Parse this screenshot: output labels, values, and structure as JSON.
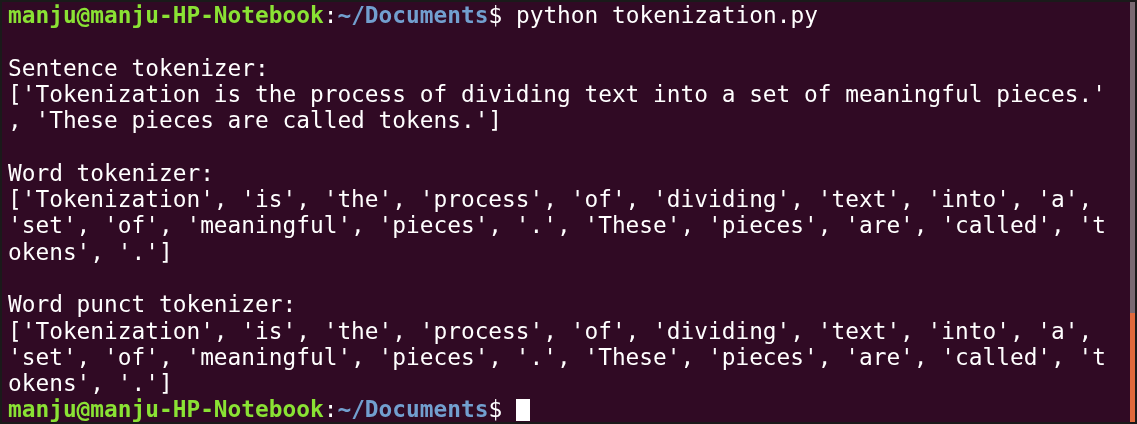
{
  "terminal": {
    "lines": [
      {
        "kind": "prompt",
        "user_host": "manju@manju-HP-Notebook",
        "separator": ":",
        "path": "~/Documents",
        "symbol": "$",
        "command": "python tokenization.py",
        "cursor": false
      },
      {
        "kind": "blank"
      },
      {
        "kind": "output",
        "text": "Sentence tokenizer:"
      },
      {
        "kind": "output",
        "text": "['Tokenization is the process of dividing text into a set of meaningful pieces.'"
      },
      {
        "kind": "output",
        "text": ", 'These pieces are called tokens.']"
      },
      {
        "kind": "blank"
      },
      {
        "kind": "output",
        "text": "Word tokenizer:"
      },
      {
        "kind": "output",
        "text": "['Tokenization', 'is', 'the', 'process', 'of', 'dividing', 'text', 'into', 'a',"
      },
      {
        "kind": "output",
        "text": "'set', 'of', 'meaningful', 'pieces', '.', 'These', 'pieces', 'are', 'called', 't"
      },
      {
        "kind": "output",
        "text": "okens', '.']"
      },
      {
        "kind": "blank"
      },
      {
        "kind": "output",
        "text": "Word punct tokenizer:"
      },
      {
        "kind": "output",
        "text": "['Tokenization', 'is', 'the', 'process', 'of', 'dividing', 'text', 'into', 'a',"
      },
      {
        "kind": "output",
        "text": "'set', 'of', 'meaningful', 'pieces', '.', 'These', 'pieces', 'are', 'called', 't"
      },
      {
        "kind": "output",
        "text": "okens', '.']"
      },
      {
        "kind": "prompt",
        "user_host": "manju@manju-HP-Notebook",
        "separator": ":",
        "path": "~/Documents",
        "symbol": "$",
        "cursor": true
      }
    ]
  }
}
